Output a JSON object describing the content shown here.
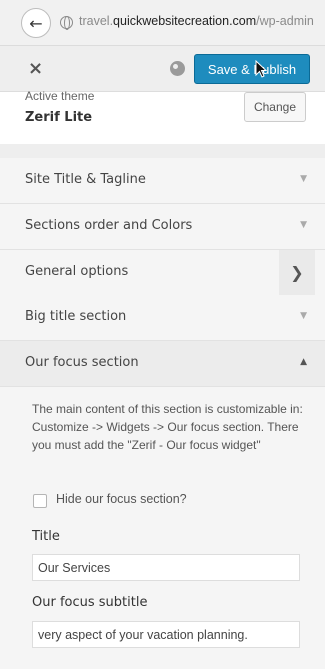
{
  "browser": {
    "url_prefix": "travel.",
    "url_domain": "quickwebsitecreation.com",
    "url_path": "/wp-admin"
  },
  "header": {
    "close_label": "×",
    "save_label": "Save & Publish"
  },
  "theme": {
    "label": "Active theme",
    "name": "Zerif Lite",
    "change_label": "Change"
  },
  "sections": [
    {
      "label": "Site Title & Tagline"
    },
    {
      "label": "Sections order and Colors"
    },
    {
      "label": "General options"
    },
    {
      "label": "Big title section"
    },
    {
      "label": "Our focus section"
    }
  ],
  "focus": {
    "description": "The main content of this section is customizable in: Customize -> Widgets -> Our focus section. There you must add the \"Zerif - Our focus widget\"",
    "hide_label": "Hide our focus section?",
    "title_label": "Title",
    "title_value": "Our Services",
    "subtitle_label": "Our focus subtitle",
    "subtitle_value": "very aspect of your vacation planning."
  }
}
